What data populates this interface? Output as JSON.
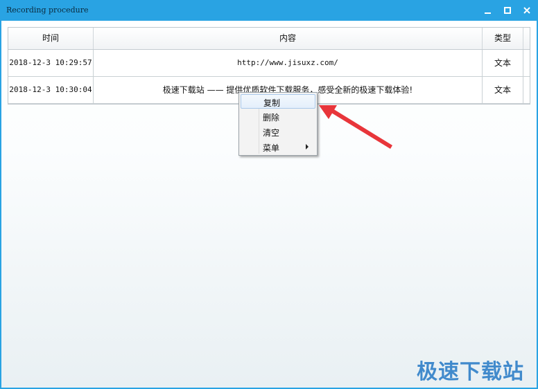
{
  "window": {
    "title": "Recording procedure",
    "minimize_icon": "minimize-icon",
    "maximize_icon": "maximize-icon",
    "close_icon": "close-icon"
  },
  "table": {
    "columns": [
      "时间",
      "内容",
      "类型"
    ],
    "rows": [
      {
        "time": "2018-12-3 10:29:57",
        "content": "http://www.jisuxz.com/",
        "type": "文本"
      },
      {
        "time": "2018-12-3 10:30:04",
        "content": "极速下载站 —— 提供优质软件下载服务，感受全新的极速下载体验!",
        "type": "文本"
      }
    ]
  },
  "context_menu": {
    "items": [
      {
        "label": "复制",
        "highlighted": true
      },
      {
        "label": "删除"
      },
      {
        "label": "清空"
      },
      {
        "label": "菜单",
        "has_submenu": true
      }
    ]
  },
  "colors": {
    "titlebar": "#29a3e3",
    "annotation_arrow": "#e8353a",
    "watermark": "#2f7fc8"
  },
  "watermark": "极速下载站"
}
